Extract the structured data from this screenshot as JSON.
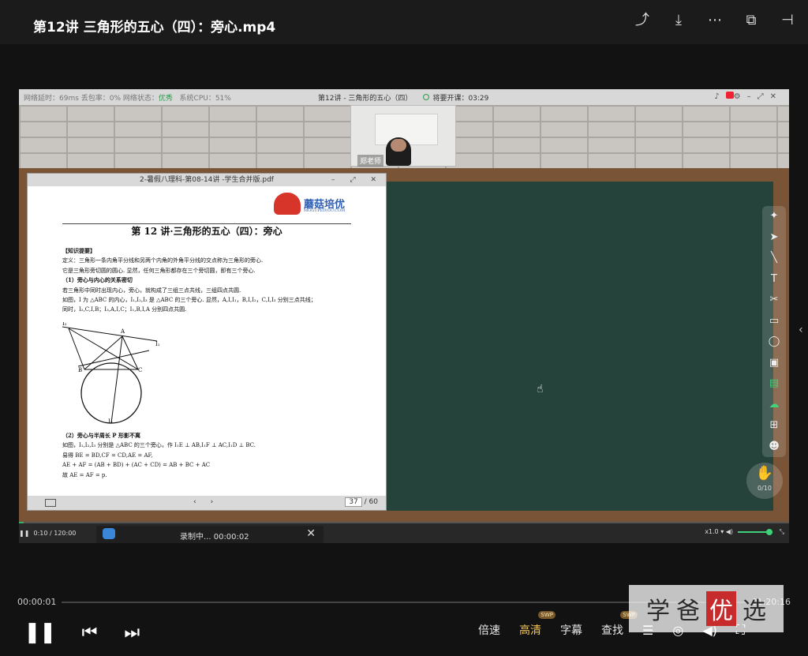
{
  "window": {
    "title": "第12讲 三角形的五心（四）：旁心.mp4"
  },
  "top_icons": [
    "share-icon",
    "download-icon",
    "more-icon",
    "pip-icon",
    "exit-icon"
  ],
  "video": {
    "status": {
      "network": "网络延时：69ms  丢包率：0%  网络状态：",
      "network_state": "优秀",
      "cpu": "系统CPU：51%",
      "class_title": "第12讲 - 三角形的五心（四）",
      "countdown": "将要开课：03:29"
    },
    "teacher_name": "郑老师",
    "pdf": {
      "title": "2-暑假八理科-第08-14讲 -学生合并版.pdf",
      "logo_text": "蘑菇培优",
      "logo_sub": "MOGUPEIYOU.COM",
      "heading": "第 12 讲·三角形的五心（四）：旁心",
      "section": "【知识提要】",
      "lines": [
        "定义：三角形一条内角平分线和另两个内角的外角平分线的交点称为三角形的旁心.",
        "它是三角形旁切圆的圆心. 显然，任何三角形都存在三个旁切圆，即有三个旁心.",
        "（1）旁心与内心的关系密切",
        "若三角形中同时出现内心，旁心，就构成了三组三点共线，三组四点共圆.",
        "如图，I 为 △ABC 的内心，I₁,I₂,I₃ 是 △ABC 的三个旁心. 显然，A,I,I₁，B,I,I₂，C,I,I₃ 分别三点共线；",
        "同时，I₂,C,I,B；I₃,A,I,C；I₁,B,I,A 分别四点共圆."
      ],
      "lines2": [
        "（2）旁心与半周长 P 形影不离",
        "如图，I₁,I₂,I₃ 分别是 △ABC 的三个旁心，作 I₁E ⊥ AB,I₁F ⊥ AC,I₁D ⊥ BC.",
        "易得 BE = BD,CF = CD,AE = AF,",
        "AE + AF = (AB + BD) + (AC + CD) = AB + BC + AC",
        "故 AE = AF = p."
      ],
      "page_current": "37",
      "page_total": "/ 60"
    },
    "hand_count": "0/10",
    "inner_time": "0:10  /  120:00",
    "recording": "录制中... 00:00:02",
    "speed": "x1.0"
  },
  "player": {
    "time_current": "00:00:01",
    "time_total": "01:20:16",
    "speed_label": "倍速",
    "quality_label": "高清",
    "subtitle_label": "字幕",
    "search_label": "查找",
    "swp_badge": "SWP"
  },
  "watermark": {
    "chars": [
      "学",
      "爸",
      "优",
      "选"
    ]
  }
}
